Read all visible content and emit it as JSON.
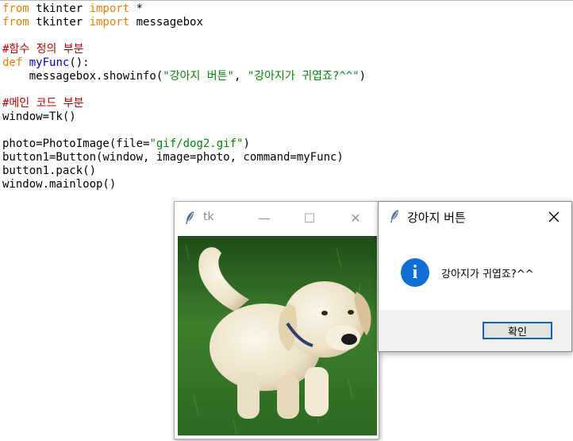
{
  "code": {
    "l1": {
      "kw1": "from",
      "a": " tkinter ",
      "kw2": "import",
      "b": " *"
    },
    "l2": {
      "kw1": "from",
      "a": " tkinter ",
      "kw2": "import",
      "b": " messagebox"
    },
    "l4": {
      "comment": "#함수 정의 부분"
    },
    "l5": {
      "kw": "def",
      "sp": " ",
      "fn": "myFunc",
      "rest": "():"
    },
    "l6": {
      "pre": "    messagebox.showinfo(",
      "s1": "\"강아지 버튼\"",
      "mid": ", ",
      "s2": "\"강아지가 귀엽죠?^^\"",
      "post": ")"
    },
    "l8": {
      "comment": "#메인 코드 부분"
    },
    "l9": {
      "text": "window=Tk()"
    },
    "l11": {
      "pre": "photo=PhotoImage(file=",
      "s": "\"gif/dog2.gif\"",
      "post": ")"
    },
    "l12": {
      "text": "button1=Button(window, image=photo, command=myFunc)"
    },
    "l13": {
      "text": "button1.pack()"
    },
    "l14": {
      "text": "window.mainloop()"
    }
  },
  "tk_window": {
    "title": "tk",
    "minimize": "—",
    "maximize": "☐",
    "close": "✕"
  },
  "dialog": {
    "title": "강아지 버튼",
    "icon_text": "i",
    "message": "강아지가 귀엽죠?^^",
    "ok_label": "확인"
  },
  "colors": {
    "keyword": "#f07c00",
    "comment": "#c00000",
    "function": "#0000cc",
    "string": "#008a00",
    "info_icon": "#0f6fd6",
    "ok_border": "#0a64c8"
  }
}
